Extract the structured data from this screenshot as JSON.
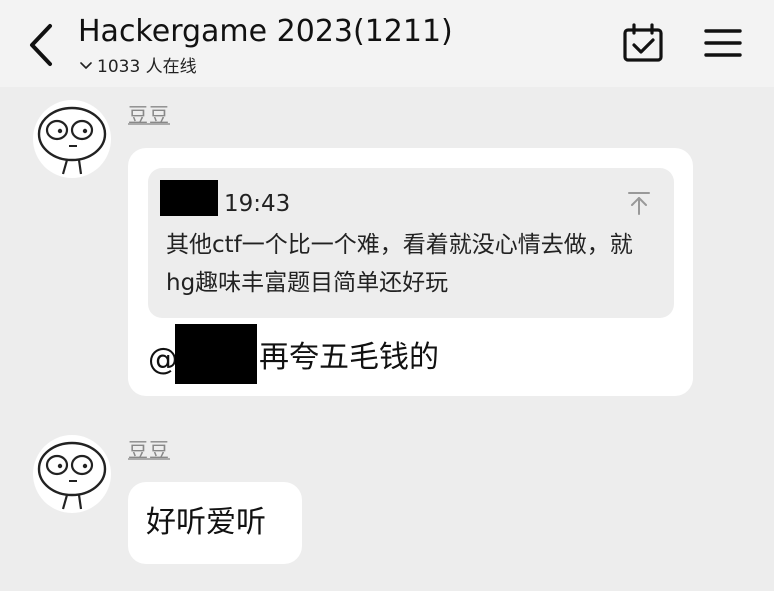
{
  "header": {
    "title": "Hackergame 2023(1211)",
    "online_count": "1033 人在线",
    "back_icon": "chevron-left-icon",
    "calendar_icon": "calendar-check-icon",
    "menu_icon": "hamburger-menu-icon"
  },
  "messages": [
    {
      "sender": "豆豆",
      "avatar_icon": "cartoon-face-avatar",
      "quote": {
        "time": "19:43",
        "text": "其他ctf一个比一个难，看着就没心情去做，就hg趣味丰富题目简单还好玩",
        "icon": "jump-to-top-icon"
      },
      "mention_prefix": "@",
      "text": "再夸五毛钱的"
    },
    {
      "sender": "豆豆",
      "avatar_icon": "cartoon-face-avatar",
      "text": "好听爱听"
    }
  ],
  "colors": {
    "background": "#ededed",
    "header": "#f3f3f3",
    "bubble": "#ffffff",
    "quote": "#ededed",
    "redaction": "#000000"
  }
}
